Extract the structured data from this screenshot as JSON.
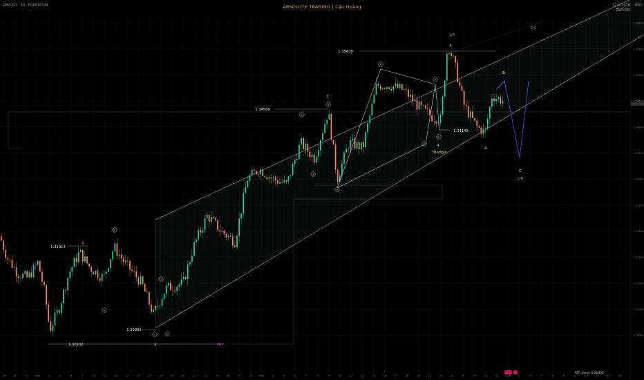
{
  "header": {
    "symbol": "GBPUSD · 4h · FOREXCOM",
    "title": "ABSOLUTE TRADING | Cậu Hoàng",
    "date": "12/1/2026",
    "pair": "GBPUSD",
    "currency": "USD",
    "atr": "ATR Value 0.00402"
  },
  "chart_data": {
    "type": "line",
    "ylim": [
      1.293,
      1.362
    ],
    "y_ticks": [
      1.3,
      1.305,
      1.31,
      1.315,
      1.32,
      1.325,
      1.33,
      1.335,
      1.34,
      1.345,
      1.35,
      1.355,
      1.36
    ],
    "price_levels": [
      {
        "label": "1.35678",
        "value": 1.35678
      },
      {
        "label": "1.34559",
        "value": 1.34559
      },
      {
        "label": "1.34142",
        "value": 1.34142
      },
      {
        "label": "1.31913",
        "value": 1.31913
      },
      {
        "label": "1.30381",
        "value": 1.30381
      },
      {
        "label": "1.30102",
        "value": 1.30102
      }
    ],
    "wave_labels": [
      "1/A",
      "5",
      "3/C",
      "3",
      "B",
      "4",
      "Triangle",
      "A",
      "C",
      "2/B",
      "1",
      "2",
      "WIV"
    ],
    "sub_waves": [
      "a",
      "b",
      "c",
      "d",
      "e",
      "i",
      "ii"
    ],
    "x_ticks": [
      "29",
      "30",
      "31",
      "Nov",
      "4",
      "5",
      "6",
      "7",
      "10",
      "11",
      "12",
      "13",
      "14",
      "17",
      "18",
      "19",
      "20",
      "21",
      "24",
      "25",
      "26",
      "27",
      "28",
      "Dec",
      "2",
      "3",
      "4",
      "5",
      "8",
      "9",
      "10",
      "11",
      "12",
      "15",
      "16",
      "17",
      "18",
      "19",
      "22",
      "23",
      "24",
      "26",
      "29",
      "30",
      "31",
      "2026",
      "5",
      "6",
      "7",
      "8",
      "9",
      "12",
      "13",
      "14",
      "15",
      "16"
    ]
  }
}
